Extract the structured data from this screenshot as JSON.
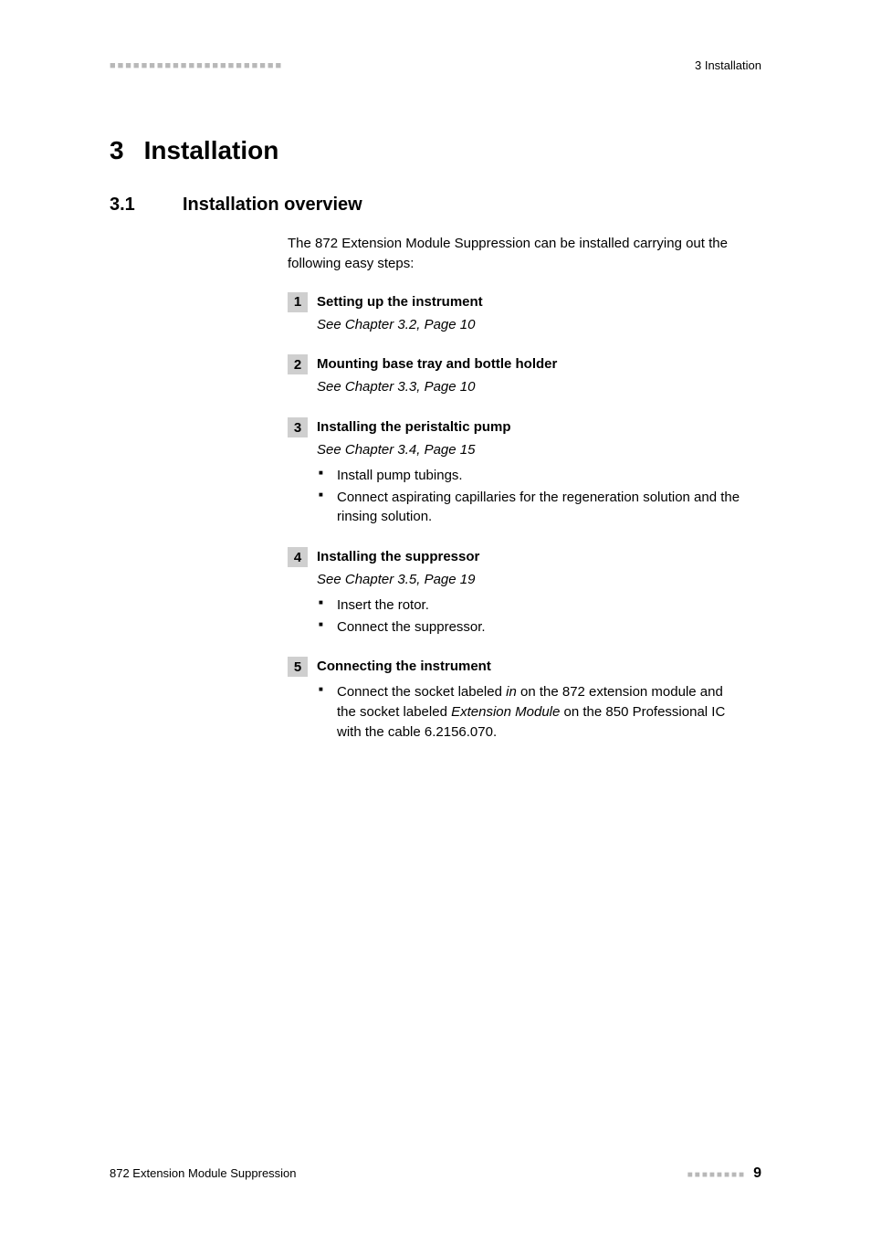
{
  "header": {
    "left_decoration": "■■■■■■■■■■■■■■■■■■■■■■",
    "right_text": "3 Installation"
  },
  "chapter": {
    "number": "3",
    "title": "Installation"
  },
  "section": {
    "number": "3.1",
    "title": "Installation overview"
  },
  "intro": "The 872 Extension Module Suppression can be installed carrying out the following easy steps:",
  "steps": [
    {
      "number": "1",
      "title": "Setting up the instrument",
      "reference": "See Chapter 3.2, Page 10",
      "bullets": []
    },
    {
      "number": "2",
      "title": "Mounting base tray and bottle holder",
      "reference": "See Chapter 3.3, Page 10",
      "bullets": []
    },
    {
      "number": "3",
      "title": "Installing the peristaltic pump",
      "reference": "See Chapter 3.4, Page 15",
      "bullets": [
        "Install pump tubings.",
        "Connect aspirating capillaries for the regeneration solution and the rinsing solution."
      ]
    },
    {
      "number": "4",
      "title": "Installing the suppressor",
      "reference": "See Chapter 3.5, Page 19",
      "bullets": [
        "Insert the rotor.",
        "Connect the suppressor."
      ]
    },
    {
      "number": "5",
      "title": "Connecting the instrument",
      "reference": "",
      "bullets_rich": [
        {
          "pre": "Connect the socket labeled ",
          "em1": "in",
          "mid": " on the 872 extension module and the socket labeled ",
          "em2": "Extension Module",
          "post": " on the 850 Professional IC with the cable 6.2156.070."
        }
      ]
    }
  ],
  "footer": {
    "left": "872 Extension Module Suppression",
    "dots": "■■■■■■■■",
    "page": "9"
  }
}
